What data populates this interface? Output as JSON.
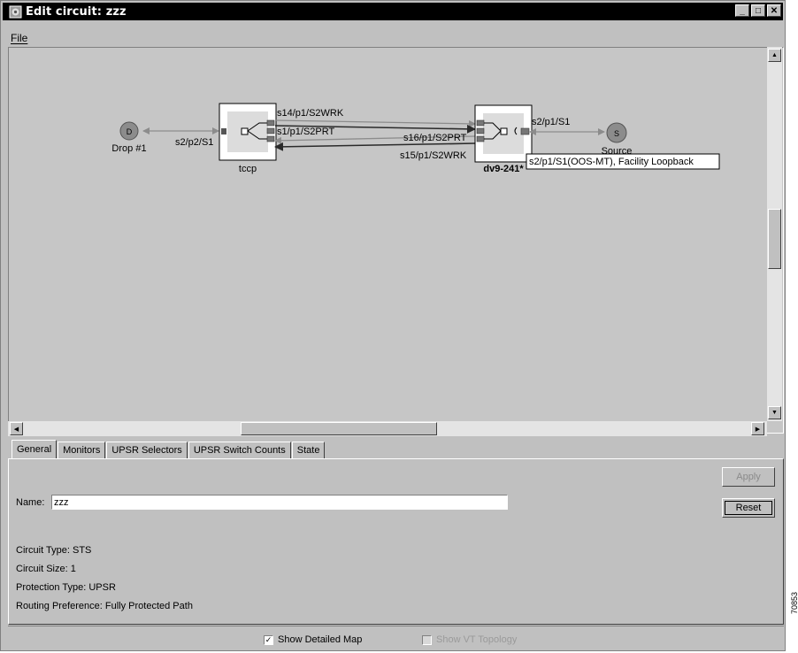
{
  "window": {
    "title": "Edit circuit: zzz",
    "minimize_label": "_",
    "maximize_label": "□",
    "close_label": "✕"
  },
  "menu": {
    "file": "File"
  },
  "map": {
    "drop_node_letter": "D",
    "drop_node_label": "Drop #1",
    "drop_link_label": "s2/p2/S1",
    "source_node_letter": "S",
    "source_node_label": "Source",
    "source_link_label": "s2/p1/S1",
    "left_node_label": "tccp",
    "right_node_label": "dv9-241*",
    "span_labels": [
      "s14/p1/S2WRK",
      "s1/p1/S2PRT",
      "s16/p1/S2PRT",
      "s15/p1/S2WRK"
    ],
    "tooltip": "s2/p1/S1(OOS-MT), Facility Loopback"
  },
  "tabs": [
    "General",
    "Monitors",
    "UPSR Selectors",
    "UPSR Switch Counts",
    "State"
  ],
  "general": {
    "name_label": "Name:",
    "name_value": "zzz",
    "apply_label": "Apply",
    "reset_label": "Reset",
    "circuit_type": "Circuit Type:  STS",
    "circuit_size": "Circuit Size:  1",
    "protection_type": "Protection Type:  UPSR",
    "routing_preference": "Routing Preference:  Fully Protected Path"
  },
  "options": {
    "show_detailed_map": "Show Detailed Map",
    "show_vt_topology": "Show VT Topology"
  },
  "side_tag": "70853"
}
